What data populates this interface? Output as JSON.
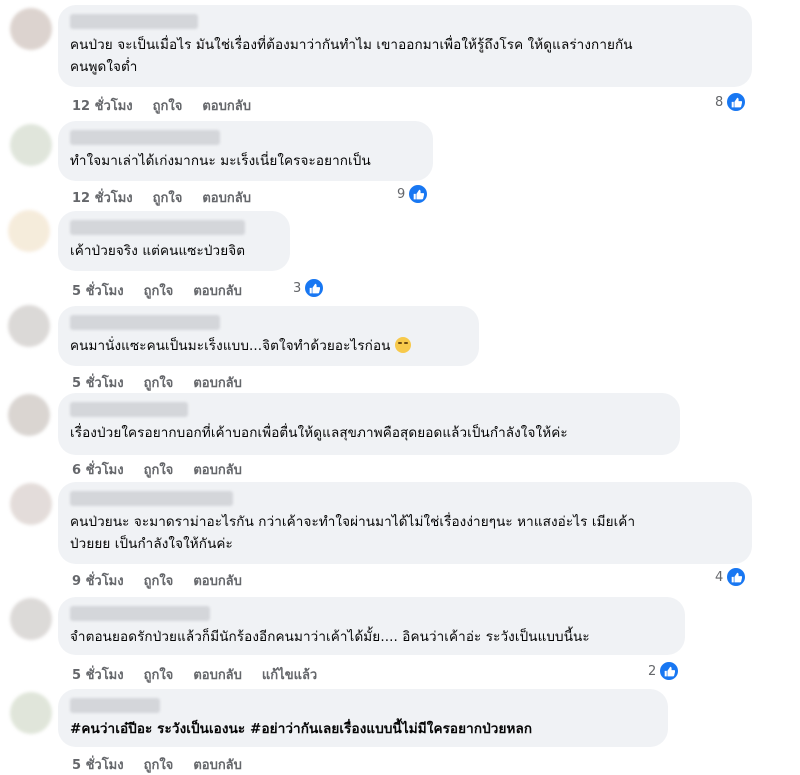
{
  "colors": {
    "bubble": "#f0f2f5",
    "meta": "#65676b",
    "like": "#1877f2"
  },
  "comments": [
    {
      "text": "คนป่วย จะเป็นเมื่อไร มันใช่เรื่องที่ต้องมาว่ากันทำไม เขาออกมาเพื่อให้รู้ถึงโรค ให้ดูแลร่างกายกัน\nคนพูดใจต่ำ",
      "time": "12 ชั่วโมง",
      "like": "ถูกใจ",
      "reply": "ตอบกลับ",
      "reactions": "8"
    },
    {
      "text": "ทำใจมาเล่าได้เก่งมากนะ มะเร็งเนี่ยใครจะอยากเป็น",
      "time": "12 ชั่วโมง",
      "like": "ถูกใจ",
      "reply": "ตอบกลับ",
      "reactions": "9"
    },
    {
      "text": "เค้าป่วยจริง แต่คนแซะป่วยจิต",
      "time": "5 ชั่วโมง",
      "like": "ถูกใจ",
      "reply": "ตอบกลับ",
      "reactions": "3"
    },
    {
      "text": "คนมานั่งแซะคนเป็นมะเร็งแบบ...จิตใจทำด้วยอะไรก่อน",
      "emoji": "face-with-symbols-emoji",
      "time": "5 ชั่วโมง",
      "like": "ถูกใจ",
      "reply": "ตอบกลับ"
    },
    {
      "text": "เรื่องป่วยใครอยากบอกที่เค้าบอกเพื่อตื่นให้ดูแลสุขภาพคือสุดยอดแล้วเป็นกำลังใจให้ค่ะ",
      "time": "6 ชั่วโมง",
      "like": "ถูกใจ",
      "reply": "ตอบกลับ"
    },
    {
      "text": "คนป่วยนะ จะมาดราม่าอะไรกัน กว่าเค้าจะทำใจผ่านมาได้ไม่ใช่เรื่องง่ายๆนะ หาแสงอ่ะไร เมียเค้า\nป่วยยย เป็นกำลังใจให้กันค่ะ",
      "time": "9 ชั่วโมง",
      "like": "ถูกใจ",
      "reply": "ตอบกลับ",
      "reactions": "4"
    },
    {
      "text": "จำตอนยอดรักป่วยแล้วก็มีนักร้องอีกคนมาว่าเค้าได้มั้ย.... อิคนว่าเค้าอ่ะ ระวังเป็นแบบนี้นะ",
      "time": "5 ชั่วโมง",
      "like": "ถูกใจ",
      "reply": "ตอบกลับ",
      "edited": "แก้ไขแล้ว",
      "reactions": "2"
    },
    {
      "text": "#คนว่าเอ๋ปีอะ ระวังเป็นเองนะ #อย่าว่ากันเลยเรื่องแบบนี้ไม่มีใครอยากป่วยหลก",
      "time": "5 ชั่วโมง",
      "like": "ถูกใจ",
      "reply": "ตอบกลับ"
    }
  ]
}
